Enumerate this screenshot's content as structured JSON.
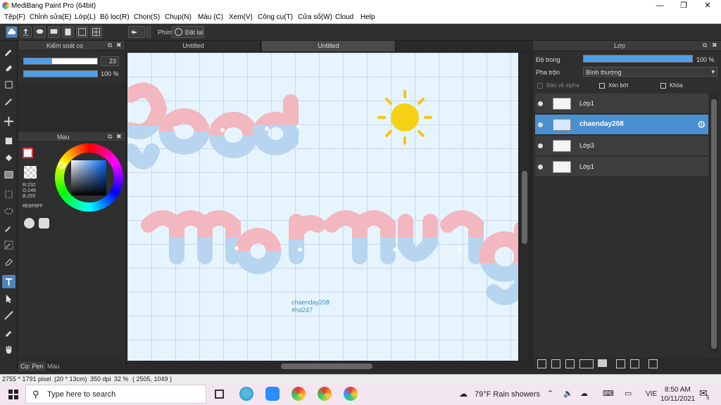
{
  "app": {
    "title": "MediBang Paint Pro (64bit)"
  },
  "menu": [
    "Tệp(F)",
    "Chỉnh sửa(E)",
    "Lớp(L)",
    "Bộ lọc(R)",
    "Chọn(S)",
    "Chụp(N)",
    "Màu (C)",
    "Xem(V)",
    "Công cụ(T)",
    "Cửa sổ(W)",
    "Cloud",
    "Help"
  ],
  "toolbar": {
    "phim_label": "Phím",
    "reset_label": "Đặt lại"
  },
  "brush_panel": {
    "title": "Kiểm soát cọ",
    "size": "23",
    "opacity": "100 %",
    "size_fraction": 0.38,
    "opacity_fraction": 1.0
  },
  "color_panel": {
    "title": "Màu",
    "r": "R:232",
    "g": "G:246",
    "b": "B:255",
    "hex": "#E8F6FF"
  },
  "bottom_tabs": {
    "pen": "Cọ: Pen",
    "color": "Màu"
  },
  "tabs": [
    "Untitled",
    "Untitled"
  ],
  "canvas_text": {
    "line1": "chaenday208",
    "line2": "#hd247"
  },
  "layer_panel": {
    "title": "Lớp",
    "opacity_label": "Độ trong",
    "opacity_value": "100 %",
    "blend_label": "Pha trộn",
    "blend_value": "Bình thường",
    "protect_alpha": "Bảo vệ alpha",
    "clip": "Xén bớt",
    "lock": "Khóa",
    "layers": [
      {
        "name": "Lớp1",
        "selected": false
      },
      {
        "name": "chaenday208",
        "selected": true
      },
      {
        "name": "Lớp3",
        "selected": false
      },
      {
        "name": "Lớp1",
        "selected": false
      }
    ]
  },
  "status": {
    "size": "2755 * 1791 pixel",
    "cm": "(20 * 13cm)",
    "dpi": "350 dpi",
    "zoom": "32 %",
    "coords": "( 2505, 1049 )"
  },
  "taskbar": {
    "search_placeholder": "Type here to search",
    "weather": "79°F  Rain showers",
    "lang": "VIE",
    "time": "8:50 AM",
    "date": "10/11/2021",
    "notif_count": "5"
  }
}
